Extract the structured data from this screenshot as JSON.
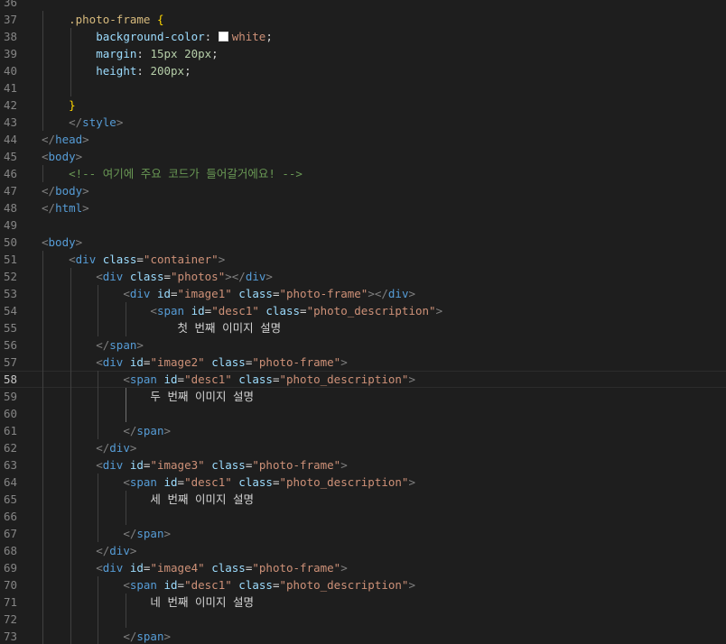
{
  "editor": {
    "language": "html",
    "current_line": "58",
    "lines": [
      {
        "n": "36",
        "g": 0,
        "tokens": []
      },
      {
        "n": "37",
        "g": 1,
        "tokens": [
          [
            "    ",
            "text"
          ],
          [
            ".photo-frame ",
            "sel"
          ],
          [
            "{",
            "brace"
          ]
        ]
      },
      {
        "n": "38",
        "g": 2,
        "tokens": [
          [
            "        ",
            "text"
          ],
          [
            "background-color",
            "prop"
          ],
          [
            ": ",
            "pun"
          ],
          [
            "",
            "swatch"
          ],
          [
            "white",
            "str"
          ],
          [
            ";",
            "pun"
          ]
        ]
      },
      {
        "n": "39",
        "g": 2,
        "tokens": [
          [
            "        ",
            "text"
          ],
          [
            "margin",
            "prop"
          ],
          [
            ": ",
            "pun"
          ],
          [
            "15px 20px",
            "num"
          ],
          [
            ";",
            "pun"
          ]
        ]
      },
      {
        "n": "40",
        "g": 2,
        "tokens": [
          [
            "        ",
            "text"
          ],
          [
            "height",
            "prop"
          ],
          [
            ": ",
            "pun"
          ],
          [
            "200px",
            "num"
          ],
          [
            ";",
            "pun"
          ]
        ]
      },
      {
        "n": "41",
        "g": 2,
        "tokens": []
      },
      {
        "n": "42",
        "g": 1,
        "tokens": [
          [
            "    ",
            "text"
          ],
          [
            "}",
            "brace"
          ]
        ]
      },
      {
        "n": "43",
        "g": 1,
        "tokens": [
          [
            "    ",
            "text"
          ],
          [
            "</",
            "br"
          ],
          [
            "style",
            "tag"
          ],
          [
            ">",
            "br"
          ]
        ]
      },
      {
        "n": "44",
        "g": 0,
        "tokens": [
          [
            "</",
            "br"
          ],
          [
            "head",
            "tag"
          ],
          [
            ">",
            "br"
          ]
        ]
      },
      {
        "n": "45",
        "g": 0,
        "tokens": [
          [
            "<",
            "br"
          ],
          [
            "body",
            "tag"
          ],
          [
            ">",
            "br"
          ]
        ]
      },
      {
        "n": "46",
        "g": 1,
        "tokens": [
          [
            "    ",
            "text"
          ],
          [
            "<!-- 여기에 주요 코드가 들어갈거에요! -->",
            "com"
          ]
        ]
      },
      {
        "n": "47",
        "g": 0,
        "tokens": [
          [
            "</",
            "br"
          ],
          [
            "body",
            "tag"
          ],
          [
            ">",
            "br"
          ]
        ]
      },
      {
        "n": "48",
        "g": 0,
        "tokens": [
          [
            "</",
            "br"
          ],
          [
            "html",
            "tag"
          ],
          [
            ">",
            "br"
          ]
        ]
      },
      {
        "n": "49",
        "g": 0,
        "tokens": []
      },
      {
        "n": "50",
        "g": 0,
        "tokens": [
          [
            "<",
            "br"
          ],
          [
            "body",
            "tag"
          ],
          [
            ">",
            "br"
          ]
        ]
      },
      {
        "n": "51",
        "g": 1,
        "tokens": [
          [
            "    ",
            "text"
          ],
          [
            "<",
            "br"
          ],
          [
            "div",
            "tag"
          ],
          [
            " ",
            "text"
          ],
          [
            "class",
            "attr"
          ],
          [
            "=",
            "pun"
          ],
          [
            "\"container\"",
            "str"
          ],
          [
            ">",
            "br"
          ]
        ]
      },
      {
        "n": "52",
        "g": 2,
        "tokens": [
          [
            "        ",
            "text"
          ],
          [
            "<",
            "br"
          ],
          [
            "div",
            "tag"
          ],
          [
            " ",
            "text"
          ],
          [
            "class",
            "attr"
          ],
          [
            "=",
            "pun"
          ],
          [
            "\"photos\"",
            "str"
          ],
          [
            "></",
            "br"
          ],
          [
            "div",
            "tag"
          ],
          [
            ">",
            "br"
          ]
        ]
      },
      {
        "n": "53",
        "g": 3,
        "tokens": [
          [
            "            ",
            "text"
          ],
          [
            "<",
            "br"
          ],
          [
            "div",
            "tag"
          ],
          [
            " ",
            "text"
          ],
          [
            "id",
            "attr"
          ],
          [
            "=",
            "pun"
          ],
          [
            "\"image1\"",
            "str"
          ],
          [
            " ",
            "text"
          ],
          [
            "class",
            "attr"
          ],
          [
            "=",
            "pun"
          ],
          [
            "\"photo-frame\"",
            "str"
          ],
          [
            "></",
            "br"
          ],
          [
            "div",
            "tag"
          ],
          [
            ">",
            "br"
          ]
        ]
      },
      {
        "n": "54",
        "g": 4,
        "tokens": [
          [
            "                ",
            "text"
          ],
          [
            "<",
            "br"
          ],
          [
            "span",
            "tag"
          ],
          [
            " ",
            "text"
          ],
          [
            "id",
            "attr"
          ],
          [
            "=",
            "pun"
          ],
          [
            "\"desc1\"",
            "str"
          ],
          [
            " ",
            "text"
          ],
          [
            "class",
            "attr"
          ],
          [
            "=",
            "pun"
          ],
          [
            "\"photo_description\"",
            "str"
          ],
          [
            ">",
            "br"
          ]
        ]
      },
      {
        "n": "55",
        "g": 4,
        "tokens": [
          [
            "                    ",
            "text"
          ],
          [
            "첫 번째 이미지 설명",
            "text"
          ]
        ]
      },
      {
        "n": "56",
        "g": 2,
        "tokens": [
          [
            "        ",
            "text"
          ],
          [
            "</",
            "br"
          ],
          [
            "span",
            "tag"
          ],
          [
            ">",
            "br"
          ]
        ]
      },
      {
        "n": "57",
        "g": 2,
        "tokens": [
          [
            "        ",
            "text"
          ],
          [
            "<",
            "br"
          ],
          [
            "div",
            "tag"
          ],
          [
            " ",
            "text"
          ],
          [
            "id",
            "attr"
          ],
          [
            "=",
            "pun"
          ],
          [
            "\"image2\"",
            "str"
          ],
          [
            " ",
            "text"
          ],
          [
            "class",
            "attr"
          ],
          [
            "=",
            "pun"
          ],
          [
            "\"photo-frame\"",
            "str"
          ],
          [
            ">",
            "br"
          ]
        ]
      },
      {
        "n": "58",
        "g": 3,
        "tokens": [
          [
            "            ",
            "text"
          ],
          [
            "<",
            "br"
          ],
          [
            "span",
            "tag"
          ],
          [
            " ",
            "text"
          ],
          [
            "id",
            "attr"
          ],
          [
            "=",
            "pun"
          ],
          [
            "\"desc1\"",
            "str"
          ],
          [
            " ",
            "text"
          ],
          [
            "class",
            "attr"
          ],
          [
            "=",
            "pun"
          ],
          [
            "\"photo_description\"",
            "str"
          ],
          [
            ">",
            "br"
          ]
        ]
      },
      {
        "n": "59",
        "g": 4,
        "tokens": [
          [
            "                ",
            "text"
          ],
          [
            "두 번째 이미지 설명",
            "text"
          ]
        ]
      },
      {
        "n": "60",
        "g": 4,
        "tokens": []
      },
      {
        "n": "61",
        "g": 3,
        "tokens": [
          [
            "            ",
            "text"
          ],
          [
            "</",
            "br"
          ],
          [
            "span",
            "tag"
          ],
          [
            ">",
            "br"
          ]
        ]
      },
      {
        "n": "62",
        "g": 2,
        "tokens": [
          [
            "        ",
            "text"
          ],
          [
            "</",
            "br"
          ],
          [
            "div",
            "tag"
          ],
          [
            ">",
            "br"
          ]
        ]
      },
      {
        "n": "63",
        "g": 2,
        "tokens": [
          [
            "        ",
            "text"
          ],
          [
            "<",
            "br"
          ],
          [
            "div",
            "tag"
          ],
          [
            " ",
            "text"
          ],
          [
            "id",
            "attr"
          ],
          [
            "=",
            "pun"
          ],
          [
            "\"image3\"",
            "str"
          ],
          [
            " ",
            "text"
          ],
          [
            "class",
            "attr"
          ],
          [
            "=",
            "pun"
          ],
          [
            "\"photo-frame\"",
            "str"
          ],
          [
            ">",
            "br"
          ]
        ]
      },
      {
        "n": "64",
        "g": 3,
        "tokens": [
          [
            "            ",
            "text"
          ],
          [
            "<",
            "br"
          ],
          [
            "span",
            "tag"
          ],
          [
            " ",
            "text"
          ],
          [
            "id",
            "attr"
          ],
          [
            "=",
            "pun"
          ],
          [
            "\"desc1\"",
            "str"
          ],
          [
            " ",
            "text"
          ],
          [
            "class",
            "attr"
          ],
          [
            "=",
            "pun"
          ],
          [
            "\"photo_description\"",
            "str"
          ],
          [
            ">",
            "br"
          ]
        ]
      },
      {
        "n": "65",
        "g": 4,
        "tokens": [
          [
            "                ",
            "text"
          ],
          [
            "세 번째 이미지 설명",
            "text"
          ]
        ]
      },
      {
        "n": "66",
        "g": 4,
        "tokens": []
      },
      {
        "n": "67",
        "g": 3,
        "tokens": [
          [
            "            ",
            "text"
          ],
          [
            "</",
            "br"
          ],
          [
            "span",
            "tag"
          ],
          [
            ">",
            "br"
          ]
        ]
      },
      {
        "n": "68",
        "g": 2,
        "tokens": [
          [
            "        ",
            "text"
          ],
          [
            "</",
            "br"
          ],
          [
            "div",
            "tag"
          ],
          [
            ">",
            "br"
          ]
        ]
      },
      {
        "n": "69",
        "g": 2,
        "tokens": [
          [
            "        ",
            "text"
          ],
          [
            "<",
            "br"
          ],
          [
            "div",
            "tag"
          ],
          [
            " ",
            "text"
          ],
          [
            "id",
            "attr"
          ],
          [
            "=",
            "pun"
          ],
          [
            "\"image4\"",
            "str"
          ],
          [
            " ",
            "text"
          ],
          [
            "class",
            "attr"
          ],
          [
            "=",
            "pun"
          ],
          [
            "\"photo-frame\"",
            "str"
          ],
          [
            ">",
            "br"
          ]
        ]
      },
      {
        "n": "70",
        "g": 3,
        "tokens": [
          [
            "            ",
            "text"
          ],
          [
            "<",
            "br"
          ],
          [
            "span",
            "tag"
          ],
          [
            " ",
            "text"
          ],
          [
            "id",
            "attr"
          ],
          [
            "=",
            "pun"
          ],
          [
            "\"desc1\"",
            "str"
          ],
          [
            " ",
            "text"
          ],
          [
            "class",
            "attr"
          ],
          [
            "=",
            "pun"
          ],
          [
            "\"photo_description\"",
            "str"
          ],
          [
            ">",
            "br"
          ]
        ]
      },
      {
        "n": "71",
        "g": 4,
        "tokens": [
          [
            "                ",
            "text"
          ],
          [
            "네 번째 이미지 설명",
            "text"
          ]
        ]
      },
      {
        "n": "72",
        "g": 4,
        "tokens": []
      },
      {
        "n": "73",
        "g": 3,
        "tokens": [
          [
            "            ",
            "text"
          ],
          [
            "</",
            "br"
          ],
          [
            "span",
            "tag"
          ],
          [
            ">",
            "br"
          ]
        ]
      }
    ]
  },
  "colors": {
    "background": "#1e1e1e",
    "line_number": "#858585",
    "tag": "#569cd6",
    "attribute": "#9cdcfe",
    "string": "#ce9178",
    "comment": "#6a9955",
    "selector": "#d7ba7d",
    "number": "#b5cea8",
    "brace": "#ffd700"
  }
}
